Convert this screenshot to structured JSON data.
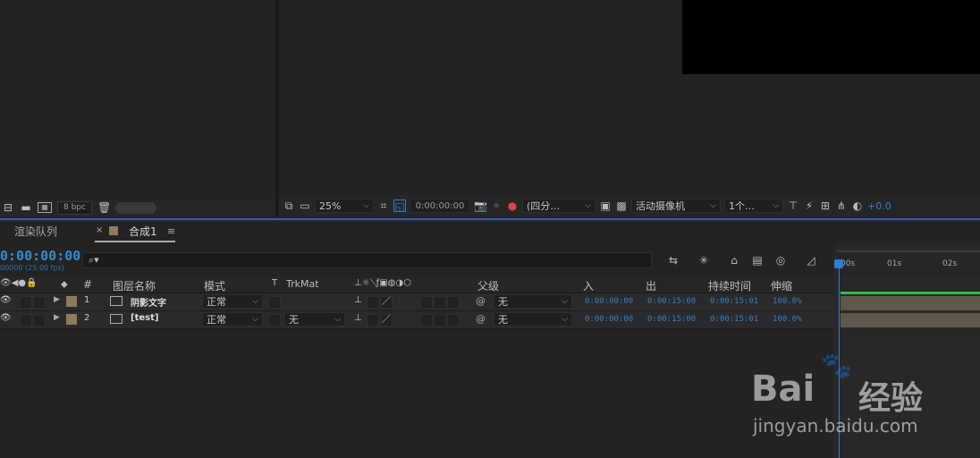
{
  "colors": {
    "accent_blue": "#2f8fd8",
    "label_tan": "#8e7a5e",
    "green": "#35b84a"
  },
  "left_panel": {
    "bpc_label": "8 bpc",
    "icons": [
      "flowchart-icon",
      "folder-icon",
      "composition-icon",
      "trash-icon"
    ]
  },
  "viewer_toolbar": {
    "zoom": "25%",
    "timecode": "0:00:00:00",
    "resolution": "(四分…",
    "camera": "活动摄像机",
    "views": "1个…",
    "exposure": "+0.0"
  },
  "tabs": {
    "render_queue": "渲染队列",
    "comp": "合成1",
    "close": "×",
    "menu": "≡"
  },
  "timeline": {
    "timecode": "0:00:00:00",
    "fps": "00000 (25.00 fps)",
    "search_icon": "⌕▾",
    "columns": {
      "num": "#",
      "layer_name": "图层名称",
      "mode": "模式",
      "t": "T",
      "trkmat": "TrkMat",
      "parent": "父级",
      "in": "入",
      "out": "出",
      "duration": "持续时间",
      "stretch": "伸缩"
    },
    "layers": [
      {
        "num": "1",
        "name": "阴影文字",
        "mode": "正常",
        "trkmat": "",
        "parent": "无",
        "in": "0:00:00:00",
        "out": "0:00:15:00",
        "duration": "0:00:15:01",
        "stretch": "100.0%"
      },
      {
        "num": "2",
        "name": "[test]",
        "mode": "正常",
        "trkmat": "无",
        "parent": "无",
        "in": "0:00:00:00",
        "out": "0:00:15:00",
        "duration": "0:00:15:01",
        "stretch": "100.0%"
      }
    ],
    "ruler": [
      "00s",
      "01s",
      "02s"
    ]
  },
  "watermark": {
    "brand": "Bai",
    "brand2": "经验",
    "url": "jingyan.baidu.com"
  }
}
